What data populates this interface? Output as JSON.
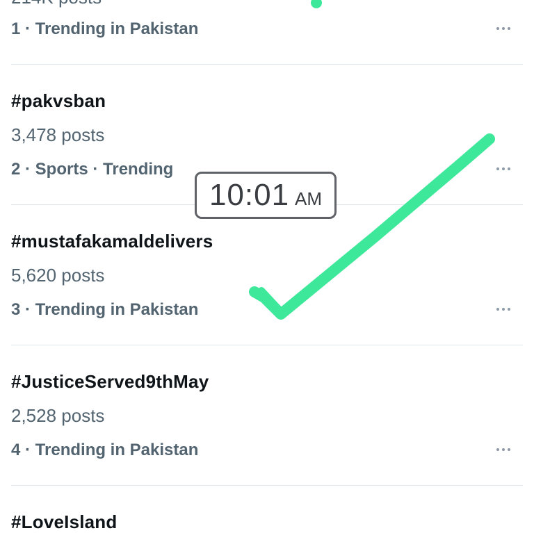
{
  "trends": [
    {
      "title": "",
      "posts": "214K posts",
      "context": "1 · Trending in Pakistan"
    },
    {
      "title": "#pakvsban",
      "posts": "3,478 posts",
      "context": "2 · Sports · Trending"
    },
    {
      "title": "#mustafakamaldelivers",
      "posts": "5,620 posts",
      "context": "3 · Trending in Pakistan"
    },
    {
      "title": "#JusticeServed9thMay",
      "posts": "2,528 posts",
      "context": "4 · Trending in Pakistan"
    },
    {
      "title": "#LoveIsland",
      "posts": "",
      "context": ""
    }
  ],
  "time_overlay": {
    "time": "10:01",
    "ampm": "AM"
  },
  "colors": {
    "title_text": "#0f1419",
    "secondary_text": "#536471",
    "divider": "#e1e6ea",
    "annotation_checkmark": "#3ee89a"
  },
  "icons": {
    "more": "more-horizontal-icon",
    "annotation": "checkmark-annotation-icon"
  }
}
